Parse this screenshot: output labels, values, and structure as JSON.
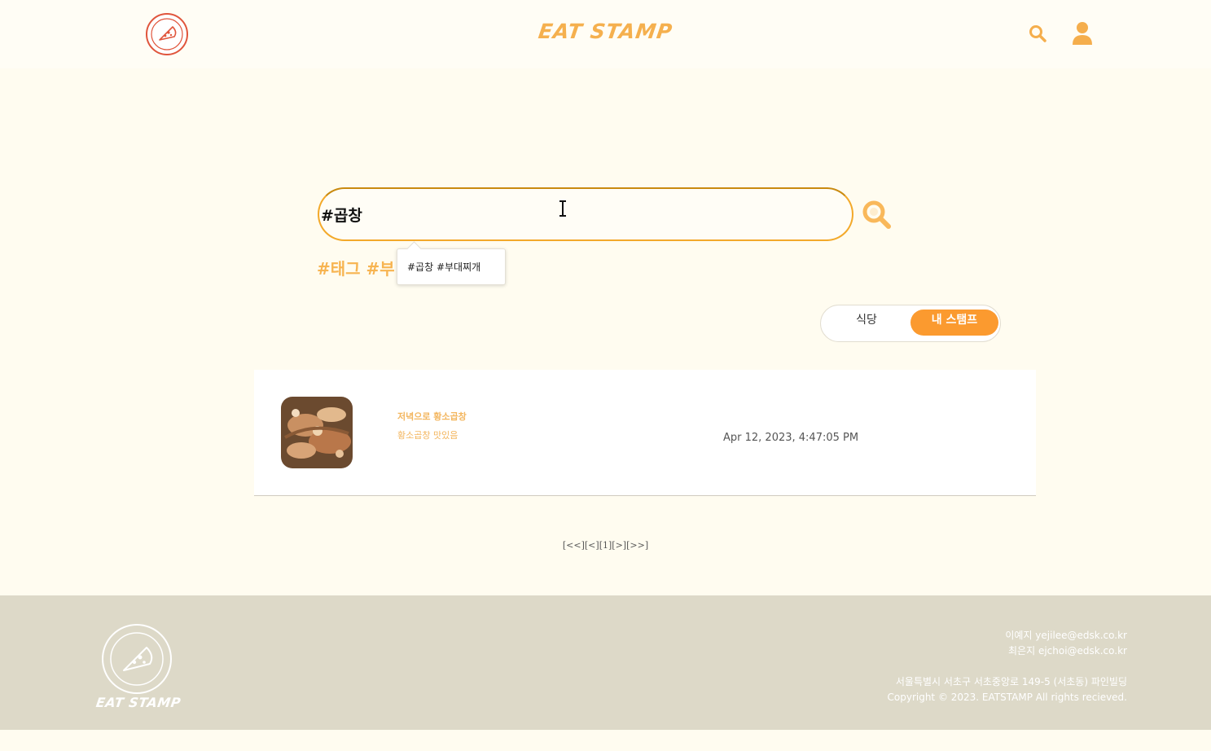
{
  "header": {
    "brand": "EAT STAMP",
    "logo_icon": "pizza-stamp-logo",
    "search_icon": "search-icon",
    "user_icon": "user-icon"
  },
  "search": {
    "value": "#곱창",
    "placeholder": "",
    "tags_preview": "#태그  #부",
    "tooltip": "#곱창 #부대찌개"
  },
  "toggle": {
    "options": [
      "식당",
      "내 스탬프"
    ],
    "selected": "내 스탬프"
  },
  "results": [
    {
      "title": "저녁으로 황소곱창",
      "description": "황소곱창 맛있음",
      "date": "Apr 12, 2023, 4:47:05 PM"
    }
  ],
  "pagination": {
    "first": "[<<]",
    "prev": "[<]",
    "current": "[1]",
    "next": "[>]",
    "last": "[>>]"
  },
  "footer": {
    "brand": "EAT STAMP",
    "contact_1": "이예지 yejilee@edsk.co.kr",
    "contact_2": "최은지 ejchoi@edsk.co.kr",
    "address": "서울특별시 서초구 서초중앙로 149-5 (서초동) 파인빌딩",
    "copyright": "Copyright © 2023. EATSTAMP All rights recieved."
  },
  "colors": {
    "accent": "#fb9a2f",
    "brand": "#f5b04e",
    "background": "#fffcf0",
    "footer": "#ddd9c8"
  }
}
